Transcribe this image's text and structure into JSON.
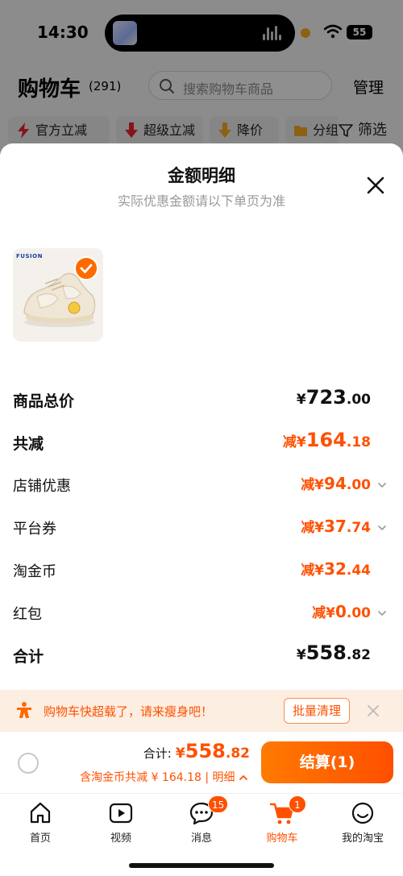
{
  "status_bar": {
    "time": "14:30",
    "battery": "55"
  },
  "cart_header": {
    "title": "购物车",
    "count": "(291)",
    "search_placeholder": "搜索购物车商品",
    "manage": "管理"
  },
  "filters": {
    "chips": [
      "官方立减",
      "超级立减",
      "降价",
      "分组"
    ],
    "filter_label": "筛选"
  },
  "sheet": {
    "title": "金额明细",
    "subtitle": "实际优惠金额请以下单页为准",
    "product": {
      "brand": "FUSION",
      "selected": true
    },
    "rows": {
      "total_price": {
        "label": "商品总价",
        "prefix": "¥",
        "int": "723",
        "dec": ".00"
      },
      "total_discount": {
        "label": "共减",
        "prefix": "减¥",
        "int": "164",
        "dec": ".18"
      },
      "store_discount": {
        "label": "店铺优惠",
        "prefix": "减¥",
        "int": "94",
        "dec": ".00"
      },
      "platform_coupon": {
        "label": "平台券",
        "prefix": "减¥",
        "int": "37",
        "dec": ".74"
      },
      "taojinbi": {
        "label": "淘金币",
        "prefix": "减¥",
        "int": "32",
        "dec": ".44"
      },
      "red_packet": {
        "label": "红包",
        "prefix": "减¥",
        "int": "0",
        "dec": ".00"
      },
      "sum": {
        "label": "合计",
        "prefix": "¥",
        "int": "558",
        "dec": ".82"
      }
    }
  },
  "banner": {
    "text": "购物车快超载了，请来瘦身吧！",
    "button": "批量清理"
  },
  "checkout": {
    "total_label": "合计:",
    "total_prefix": "¥",
    "total_int": "558",
    "total_dec": ".82",
    "savings": "含淘金币共减 ¥ 164.18 | 明细",
    "pay_button": "结算(1)"
  },
  "tabbar": {
    "tabs": [
      {
        "label": "首页"
      },
      {
        "label": "视频"
      },
      {
        "label": "消息",
        "badge": "15"
      },
      {
        "label": "购物车",
        "badge": "1"
      },
      {
        "label": "我的淘宝"
      }
    ]
  },
  "colors": {
    "accent": "#ff5000",
    "brand_orange": "#ff6a00"
  }
}
